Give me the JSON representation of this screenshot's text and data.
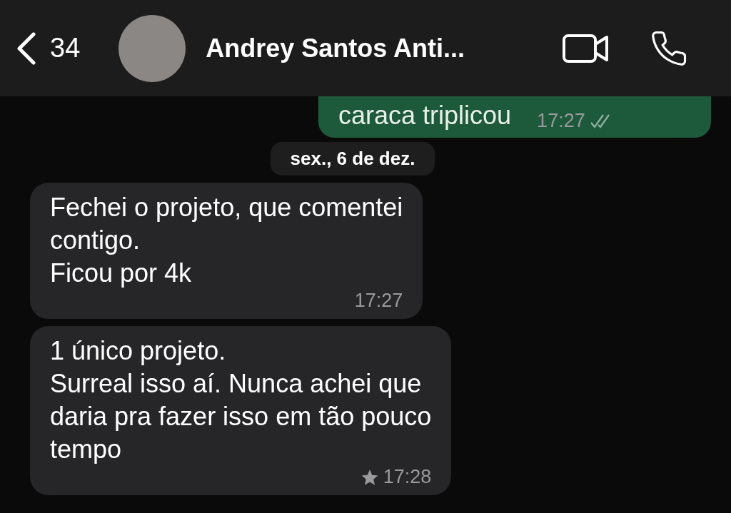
{
  "header": {
    "back_count": "34",
    "contact_name": "Andrey Santos Anti..."
  },
  "date_divider": "sex., 6 de dez.",
  "messages": [
    {
      "kind": "outgoing",
      "text": "caraca triplicou",
      "time": "17:27",
      "read": true,
      "starred": false
    },
    {
      "kind": "incoming",
      "text": "Fechei o projeto, que comentei\ncontigo.\nFicou por 4k",
      "time": "17:27",
      "starred": false
    },
    {
      "kind": "incoming",
      "text": "1 único projeto.\nSurreal isso aí. Nunca achei que\ndaria pra fazer isso em tão pouco\ntempo",
      "time": "17:28",
      "starred": true
    }
  ]
}
